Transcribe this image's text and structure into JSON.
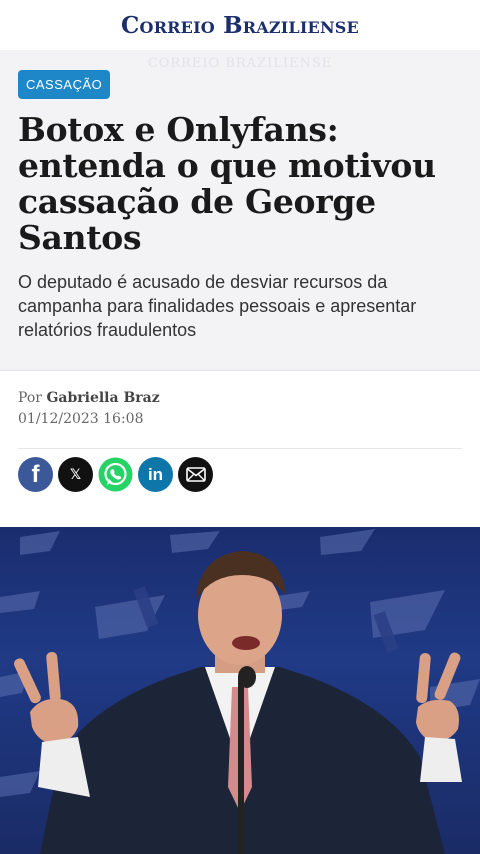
{
  "header": {
    "logo": "Correio Braziliense"
  },
  "article": {
    "ghost_text": "CORREIO BRAZILIENSE",
    "category": "CASSAÇÃO",
    "title": "Botox e Onlyfans: entenda o que motivou cassação de George Santos",
    "subtitle": "O deputado é acusado de desviar recursos da campanha para finalidades pessoais e apresentar relatórios fraudulentos",
    "byline_prefix": "Por",
    "author": "Gabriella Braz",
    "date": "01/12/2023 16:08"
  },
  "share": [
    {
      "network": "facebook",
      "icon": "facebook-icon",
      "glyph": "f"
    },
    {
      "network": "x",
      "icon": "x-icon",
      "glyph": "𝕏"
    },
    {
      "network": "whatsapp",
      "icon": "whatsapp-icon"
    },
    {
      "network": "linkedin",
      "icon": "linkedin-icon",
      "glyph": "in"
    },
    {
      "network": "email",
      "icon": "email-icon"
    }
  ],
  "colors": {
    "brand_navy": "#1b2f6b",
    "badge_blue": "#1e87c8",
    "facebook": "#3b5998",
    "whatsapp": "#25d366",
    "linkedin": "#0e76a8"
  }
}
